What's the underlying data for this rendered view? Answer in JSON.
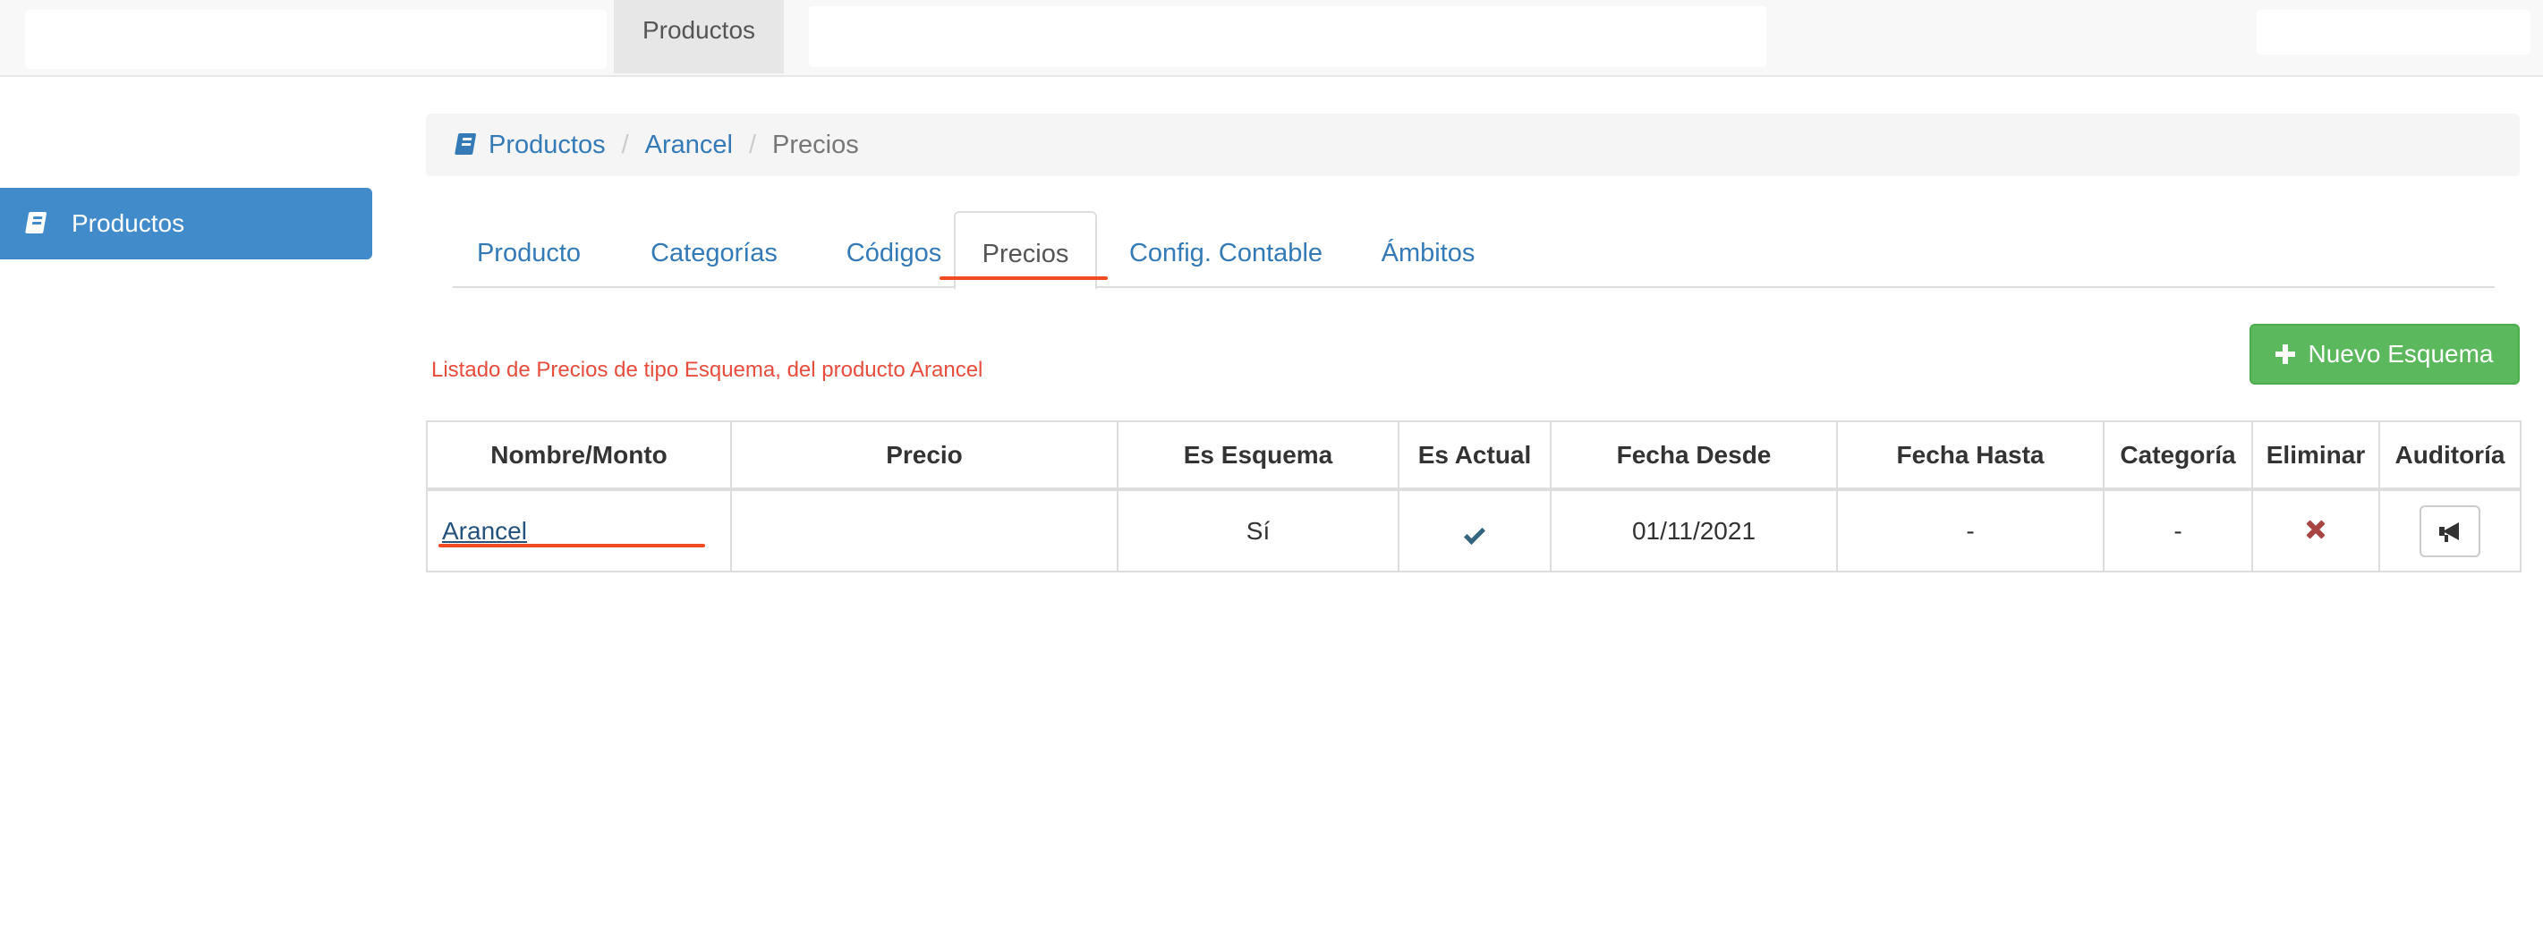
{
  "topbar": {
    "active_item": "Productos"
  },
  "sidebar": {
    "items": [
      {
        "label": "Productos",
        "icon": "book-icon"
      }
    ]
  },
  "breadcrumb": {
    "items": [
      "Productos",
      "Arancel",
      "Precios"
    ],
    "icon": "book-icon"
  },
  "tabs": [
    {
      "label": "Producto"
    },
    {
      "label": "Categorías"
    },
    {
      "label": "Códigos"
    },
    {
      "label": "Precios",
      "active": true
    },
    {
      "label": "Config. Contable"
    },
    {
      "label": "Ámbitos"
    }
  ],
  "info_text": "Listado de Precios de tipo Esquema, del producto Arancel",
  "new_button": {
    "label": "Nuevo Esquema",
    "icon": "plus-icon"
  },
  "table": {
    "headers": [
      "Nombre/Monto",
      "Precio",
      "Es Esquema",
      "Es Actual",
      "Fecha Desde",
      "Fecha Hasta",
      "Categoría",
      "Eliminar",
      "Auditoría"
    ],
    "rows": [
      {
        "nombre": "Arancel",
        "precio": "",
        "es_esquema": "Sí",
        "es_actual_icon": "check-icon",
        "fecha_desde": "01/11/2021",
        "fecha_hasta": "-",
        "categoria": "-",
        "eliminar_icon": "x-icon",
        "auditoria_icon": "megaphone-icon"
      }
    ]
  },
  "colors": {
    "primary": "#428bca",
    "link": "#337ab7",
    "success": "#5cb85c",
    "danger_text": "#e74c3c",
    "highlight_underline": "#f04b23"
  }
}
